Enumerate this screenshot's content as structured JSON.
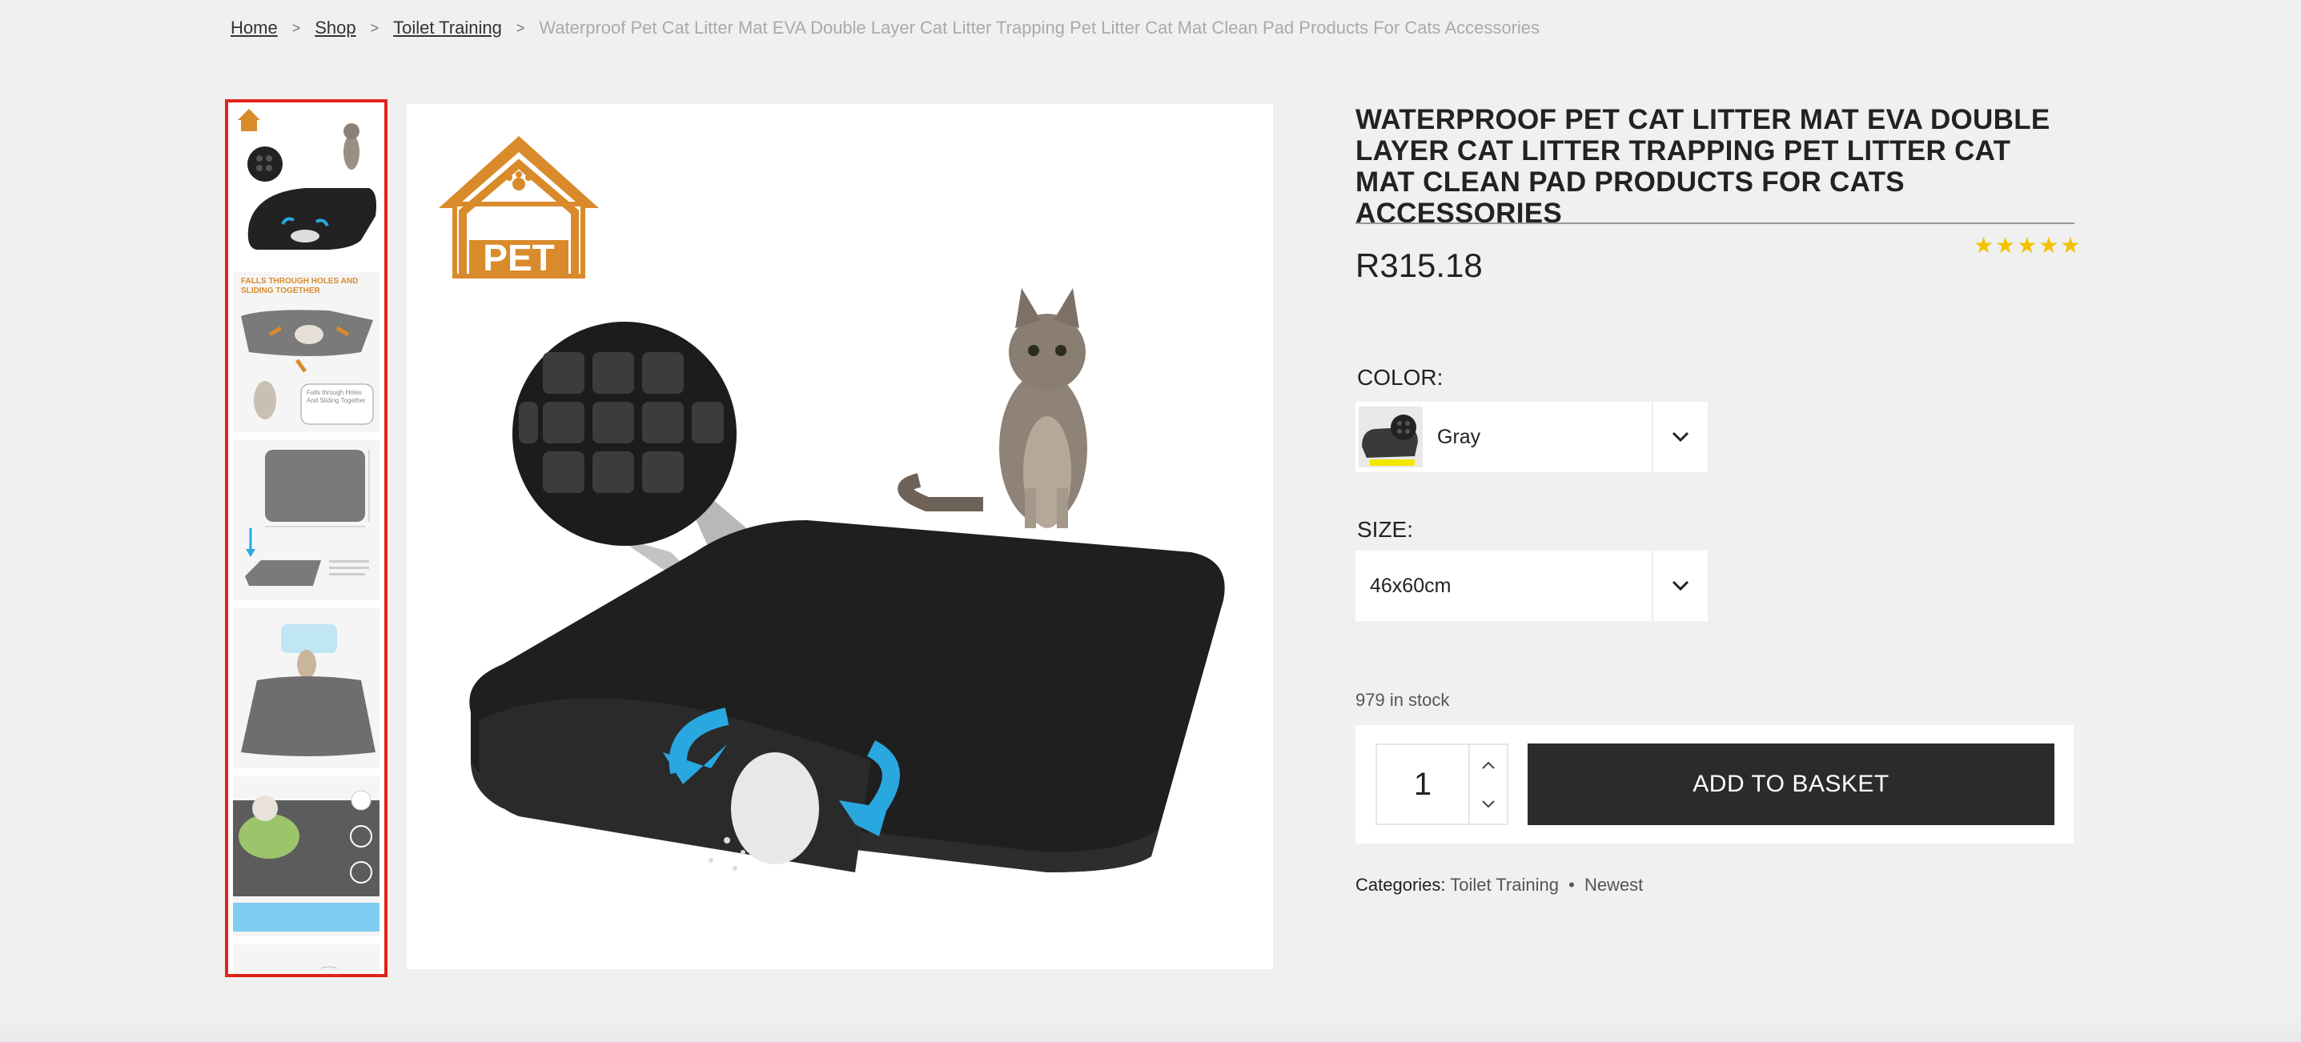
{
  "breadcrumb": {
    "home": "Home",
    "shop": "Shop",
    "category": "Toilet Training",
    "current": "Waterproof Pet Cat Litter Mat EVA Double Layer Cat Litter Trapping Pet Litter Cat Mat Clean Pad Products For Cats Accessories",
    "separator": ">"
  },
  "gallery": {
    "logo_text": "PET",
    "thumb2_heading": "FALLS THROUGH HOLES AND SLIDING TOGETHER",
    "thumb2_note": "Falls through Holes And Sliding Together"
  },
  "product": {
    "title": "Waterproof Pet Cat Litter Mat EVA Double Layer Cat Litter Trapping Pet Litter Cat Mat Clean Pad Products For Cats Accessories",
    "price": "R315.18",
    "rating_stars": "★★★★★",
    "rating_value": 5,
    "color_label": "COLOR:",
    "color_value": "Gray",
    "size_label": "SIZE:",
    "size_value": "46x60cm",
    "stock": "979 in stock",
    "quantity": "1",
    "add_to_basket": "ADD TO BASKET",
    "categories_label": "Categories:",
    "categories": [
      "Toilet Training",
      "Newest"
    ],
    "categories_separator": "•"
  },
  "colors": {
    "accent_border": "#e2231a",
    "button_bg": "#2b2b2b",
    "star": "#f2c200",
    "logo_orange": "#d98b2b",
    "arrow_blue": "#29a8e0"
  }
}
